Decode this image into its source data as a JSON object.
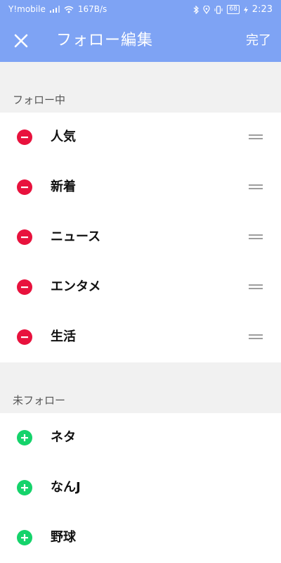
{
  "status_bar": {
    "carrier": "Y!mobile",
    "speed": "167B/s",
    "battery": "68",
    "time": "2:23"
  },
  "header": {
    "title": "フォロー編集",
    "done_label": "完了"
  },
  "following": {
    "section_label": "フォロー中",
    "items": [
      {
        "label": "人気"
      },
      {
        "label": "新着"
      },
      {
        "label": "ニュース"
      },
      {
        "label": "エンタメ"
      },
      {
        "label": "生活"
      }
    ]
  },
  "not_following": {
    "section_label": "未フォロー",
    "items": [
      {
        "label": "ネタ"
      },
      {
        "label": "なんJ"
      },
      {
        "label": "野球"
      }
    ]
  },
  "colors": {
    "header_bg": "#7ea3f4",
    "remove": "#e8123d",
    "add": "#15d36b"
  }
}
